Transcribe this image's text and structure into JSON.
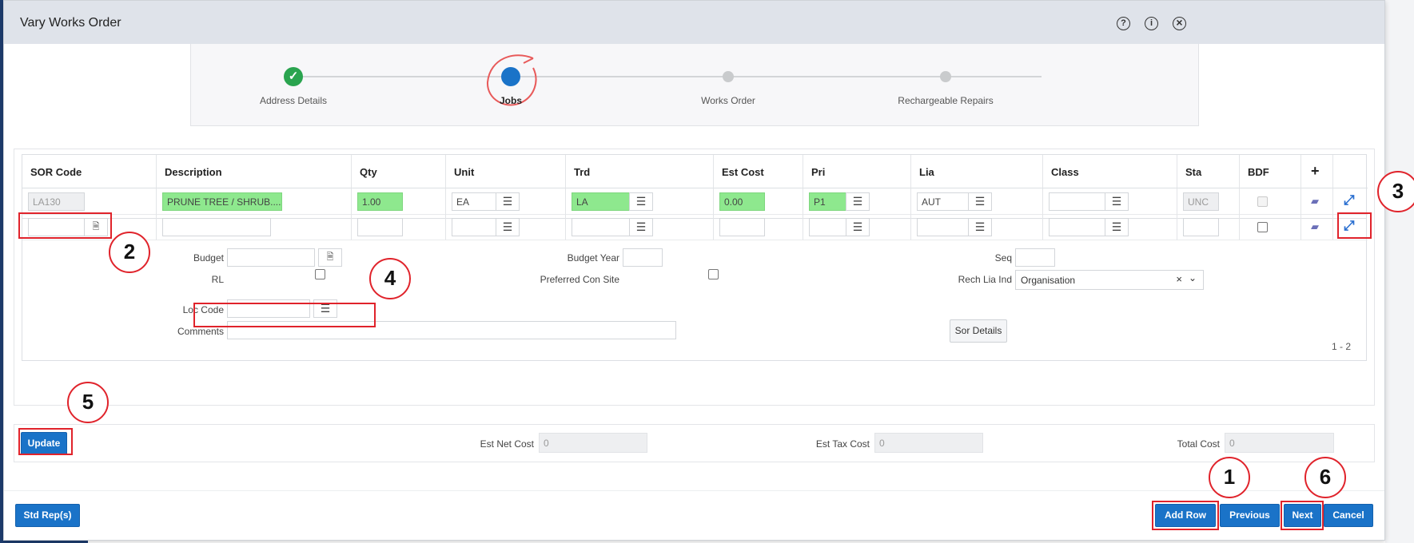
{
  "dialog": {
    "title": "Vary Works Order",
    "header_icons": [
      "help-icon",
      "info-icon",
      "close-icon"
    ],
    "help_glyph": "?",
    "info_glyph": "i",
    "close_glyph": "×"
  },
  "wizard": {
    "steps": [
      {
        "label": "Address Details",
        "state": "done"
      },
      {
        "label": "Jobs",
        "state": "active"
      },
      {
        "label": "Works Order",
        "state": "pending"
      },
      {
        "label": "Rechargeable Repairs",
        "state": "pending"
      }
    ]
  },
  "table": {
    "headers": [
      "SOR Code",
      "Description",
      "Qty",
      "Unit",
      "Trd",
      "Est Cost",
      "Pri",
      "Lia",
      "Class",
      "Sta",
      "BDF",
      "+"
    ],
    "rows": [
      {
        "sor_code": "LA130",
        "description": "PRUNE TREE / SHRUB.......(O",
        "qty": "1.00",
        "unit": "EA",
        "trd": "LA",
        "est_cost": "0.00",
        "pri": "P1",
        "lia": "AUT",
        "class": "",
        "sta": "UNC"
      },
      {
        "sor_code": "",
        "description": "",
        "qty": "",
        "unit": "",
        "trd": "",
        "est_cost": "",
        "pri": "",
        "lia": "",
        "class": "",
        "sta": ""
      }
    ],
    "pagination": "1 - 2"
  },
  "detail": {
    "budget_label": "Budget",
    "budget_year_label": "Budget Year",
    "seq_label": "Seq",
    "rl_label": "RL",
    "preferred_con_site_label": "Preferred Con Site",
    "rech_lia_ind_label": "Rech Lia Ind",
    "rech_lia_ind_value": "Organisation",
    "loc_code_label": "Loc Code",
    "comments_label": "Comments",
    "sor_details_button": "Sor Details"
  },
  "costs": {
    "update_button": "Update",
    "est_net_cost_label": "Est Net Cost",
    "est_net_cost_value": "0",
    "est_tax_cost_label": "Est Tax Cost",
    "est_tax_cost_value": "0",
    "total_cost_label": "Total Cost",
    "total_cost_value": "0"
  },
  "footer": {
    "std_reps_button": "Std Rep(s)",
    "add_row_button": "Add Row",
    "previous_button": "Previous",
    "next_button": "Next",
    "cancel_button": "Cancel"
  },
  "annotations": [
    "1",
    "2",
    "3",
    "4",
    "5",
    "6"
  ],
  "colors": {
    "primary_button": "#1a73c8",
    "required_field": "#8ee88e",
    "annotation_red": "#e0232b",
    "step_done": "#2aa44f",
    "step_active": "#1a73c8"
  }
}
